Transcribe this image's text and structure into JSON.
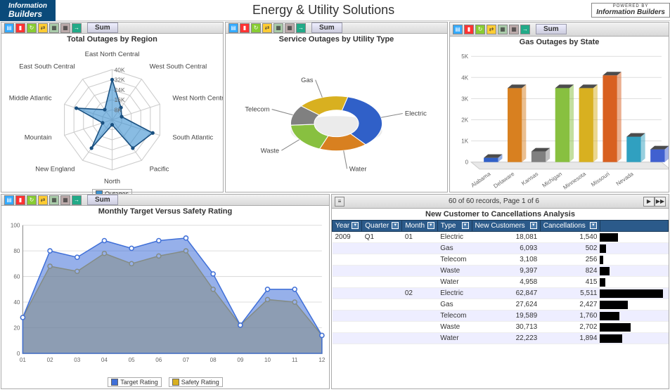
{
  "header": {
    "logo_left": {
      "line1": "Information",
      "line2": "Builders"
    },
    "title": "Energy & Utility Solutions",
    "logo_right": {
      "powered": "POWERED BY",
      "brand": "Information Builders"
    }
  },
  "toolbar": {
    "sum_label": "Sum",
    "icons": [
      "chart-icon",
      "bars-icon",
      "refresh-icon",
      "swap-icon",
      "grid-icon",
      "grid2-icon",
      "export-icon"
    ]
  },
  "panel1": {
    "title": "Total Outages by Region",
    "legend": "Outages"
  },
  "panel2": {
    "title": "Service Outages by Utility Type"
  },
  "panel3": {
    "title": "Gas Outages by State"
  },
  "panel4": {
    "title": "Monthly Target Versus Safety Rating",
    "legend1": "Target Rating",
    "legend2": "Safety Rating"
  },
  "table": {
    "pager": "60 of 60 records, Page 1 of 6",
    "title": "New Customer to Cancellations Analysis",
    "headers": [
      "Year",
      "Quarter",
      "Month",
      "Type",
      "New Customers",
      "Cancellations",
      ""
    ],
    "rows": [
      {
        "year": "2009",
        "quarter": "Q1",
        "month": "01",
        "type": "Electric",
        "new": "18,081",
        "cancel": "1,540",
        "bar": 18081
      },
      {
        "year": "",
        "quarter": "",
        "month": "",
        "type": "Gas",
        "new": "6,093",
        "cancel": "502",
        "bar": 6093
      },
      {
        "year": "",
        "quarter": "",
        "month": "",
        "type": "Telecom",
        "new": "3,108",
        "cancel": "256",
        "bar": 3108
      },
      {
        "year": "",
        "quarter": "",
        "month": "",
        "type": "Waste",
        "new": "9,397",
        "cancel": "824",
        "bar": 9397
      },
      {
        "year": "",
        "quarter": "",
        "month": "",
        "type": "Water",
        "new": "4,958",
        "cancel": "415",
        "bar": 4958
      },
      {
        "year": "",
        "quarter": "",
        "month": "02",
        "type": "Electric",
        "new": "62,847",
        "cancel": "5,511",
        "bar": 62847
      },
      {
        "year": "",
        "quarter": "",
        "month": "",
        "type": "Gas",
        "new": "27,624",
        "cancel": "2,427",
        "bar": 27624
      },
      {
        "year": "",
        "quarter": "",
        "month": "",
        "type": "Telecom",
        "new": "19,589",
        "cancel": "1,760",
        "bar": 19589
      },
      {
        "year": "",
        "quarter": "",
        "month": "",
        "type": "Waste",
        "new": "30,713",
        "cancel": "2,702",
        "bar": 30713
      },
      {
        "year": "",
        "quarter": "",
        "month": "",
        "type": "Water",
        "new": "22,223",
        "cancel": "1,894",
        "bar": 22223
      }
    ]
  },
  "chart_data": [
    {
      "type": "radar",
      "title": "Total Outages by Region",
      "categories": [
        "East North Central",
        "West South Central",
        "West North Central",
        "South Atlantic",
        "Pacific",
        "North",
        "New England",
        "Mountain",
        "Middle Atlantic",
        "East South Central"
      ],
      "ticks": [
        "8K",
        "16K",
        "24K",
        "32K",
        "40K"
      ],
      "series": [
        {
          "name": "Outages",
          "values": [
            32,
            12,
            8,
            34,
            28,
            4,
            28,
            8,
            30,
            10
          ]
        }
      ],
      "max": 40
    },
    {
      "type": "pie",
      "title": "Service Outages by Utility Type",
      "series": [
        {
          "name": "Electric",
          "value": 35,
          "color": "#3060c8"
        },
        {
          "name": "Water",
          "value": 17,
          "color": "#d88020"
        },
        {
          "name": "Waste",
          "value": 18,
          "color": "#88c040"
        },
        {
          "name": "Telecom",
          "value": 12,
          "color": "#808080"
        },
        {
          "name": "Gas",
          "value": 18,
          "color": "#d8b020"
        }
      ]
    },
    {
      "type": "bar",
      "title": "Gas Outages by State",
      "categories": [
        "Alabama",
        "Delaware",
        "Kansas",
        "Michigan",
        "Minnesota",
        "Missouri",
        "Nevada"
      ],
      "values": [
        200,
        3500,
        500,
        3500,
        3500,
        4100,
        1200,
        600
      ],
      "colors": [
        "#3060c8",
        "#d88020",
        "#808080",
        "#88c040",
        "#d8b020",
        "#d86020",
        "#30a0c0",
        "#4060d0"
      ],
      "yticks": [
        "0",
        "1K",
        "2K",
        "3K",
        "4K",
        "5K"
      ],
      "ylim": [
        0,
        5000
      ]
    },
    {
      "type": "area",
      "title": "Monthly Target Versus Safety Rating",
      "x": [
        "01",
        "02",
        "03",
        "04",
        "05",
        "06",
        "07",
        "08",
        "09",
        "10",
        "11",
        "12"
      ],
      "series": [
        {
          "name": "Target Rating",
          "values": [
            28,
            80,
            75,
            88,
            82,
            88,
            90,
            62,
            22,
            50,
            50,
            14
          ],
          "color": "#4070d8"
        },
        {
          "name": "Safety Rating",
          "values": [
            28,
            68,
            64,
            78,
            70,
            76,
            80,
            50,
            22,
            42,
            40,
            14
          ],
          "color": "#d8b020"
        }
      ],
      "ylim": [
        0,
        100
      ],
      "yticks": [
        "0",
        "20",
        "40",
        "60",
        "80",
        "100"
      ]
    }
  ]
}
